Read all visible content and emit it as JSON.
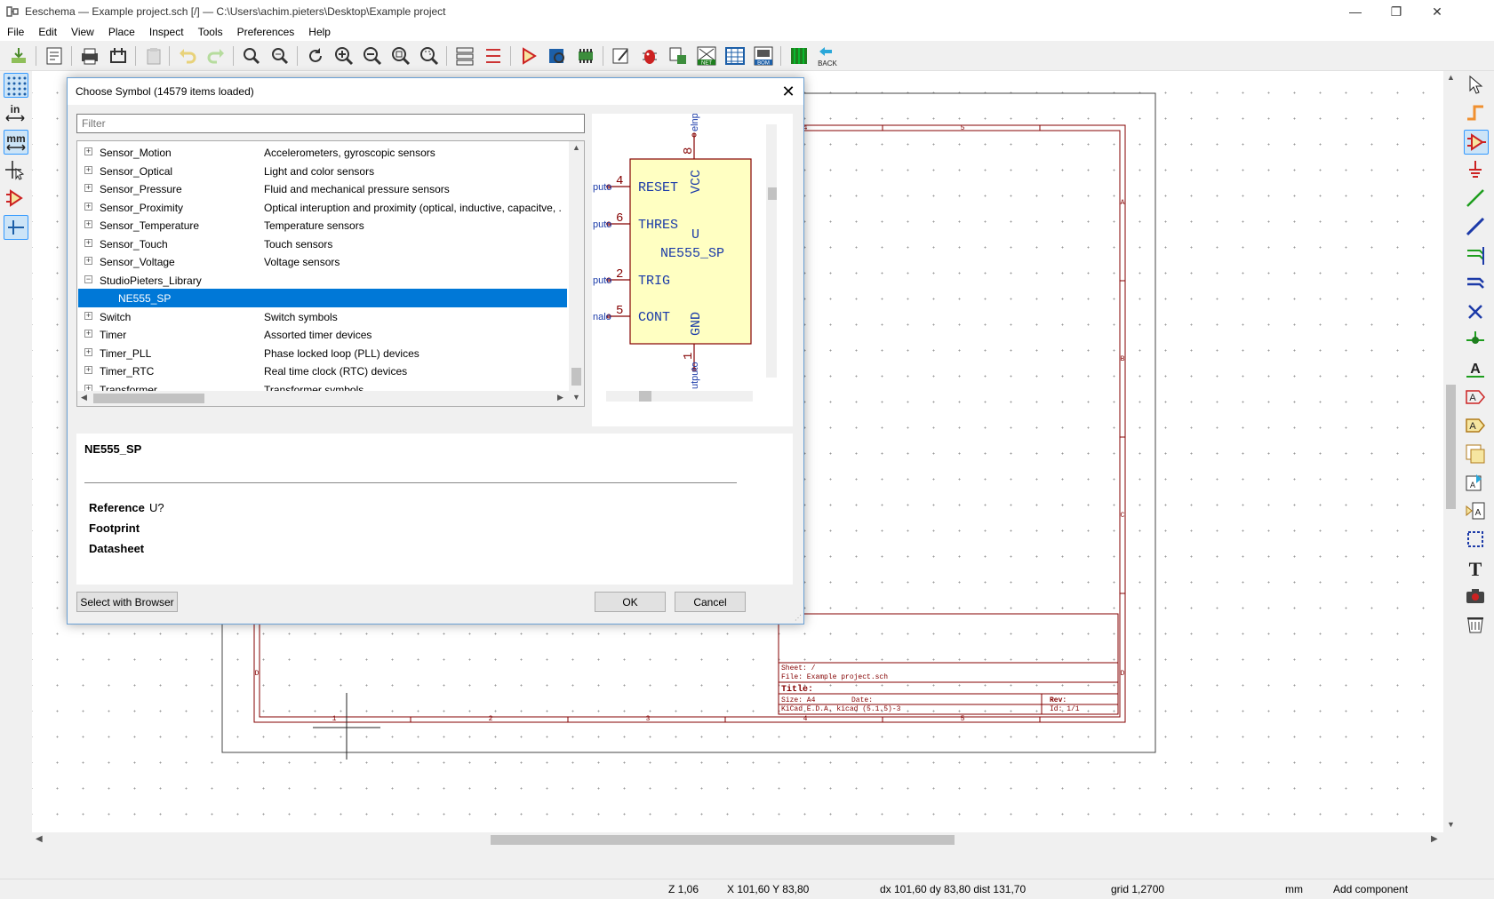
{
  "window": {
    "title": "Eeschema — Example project.sch [/] — C:\\Users\\achim.pieters\\Desktop\\Example project",
    "minimize_glyph": "—",
    "maximize_glyph": "❐",
    "close_glyph": "✕"
  },
  "menu": [
    "File",
    "Edit",
    "View",
    "Place",
    "Inspect",
    "Tools",
    "Preferences",
    "Help"
  ],
  "left_toolbar": {
    "units_in": "in",
    "units_mm": "mm"
  },
  "toolbar": {
    "back_label": "BACK",
    "net_label": "NET",
    "bom_label": "BOM"
  },
  "dialog": {
    "title": "Choose Symbol (14579 items loaded)",
    "close_glyph": "✕",
    "filter_placeholder": "Filter",
    "tree": [
      {
        "name": "Sensor_Motion",
        "desc": "Accelerometers, gyroscopic sensors",
        "exp": "+"
      },
      {
        "name": "Sensor_Optical",
        "desc": "Light and color sensors",
        "exp": "+"
      },
      {
        "name": "Sensor_Pressure",
        "desc": "Fluid and mechanical pressure sensors",
        "exp": "+"
      },
      {
        "name": "Sensor_Proximity",
        "desc": "Optical interuption and proximity (optical, inductive, capacitve, .",
        "exp": "+"
      },
      {
        "name": "Sensor_Temperature",
        "desc": "Temperature sensors",
        "exp": "+"
      },
      {
        "name": "Sensor_Touch",
        "desc": "Touch sensors",
        "exp": "+"
      },
      {
        "name": "Sensor_Voltage",
        "desc": "Voltage sensors",
        "exp": "+"
      },
      {
        "name": "StudioPieters_Library",
        "desc": "",
        "exp": "−"
      },
      {
        "name": "NE555_SP",
        "desc": "",
        "exp": ""
      },
      {
        "name": "Switch",
        "desc": "Switch symbols",
        "exp": "+"
      },
      {
        "name": "Timer",
        "desc": "Assorted timer devices",
        "exp": "+"
      },
      {
        "name": "Timer_PLL",
        "desc": "Phase locked loop (PLL) devices",
        "exp": "+"
      },
      {
        "name": "Timer_RTC",
        "desc": "Real time clock (RTC) devices",
        "exp": "+"
      },
      {
        "name": "Transformer",
        "desc": "Transformer symbols",
        "exp": "+"
      }
    ],
    "selected_index": 8,
    "preview": {
      "pins": [
        {
          "num": "4",
          "name": "RESET",
          "ext": "puto"
        },
        {
          "num": "6",
          "name": "THRES",
          "ext": "puto"
        },
        {
          "num": "2",
          "name": "TRIG",
          "ext": "puto"
        },
        {
          "num": "5",
          "name": "CONT",
          "ext": "nalo"
        }
      ],
      "top_pin_num": "8",
      "top_pin_name": "VCC",
      "top_ext": "elnput",
      "bottom_pin_num": "1",
      "bottom_pin_name": "GND",
      "bottom_ext": "utputo",
      "ref": "U",
      "value": "NE555_SP"
    },
    "info": {
      "symbol_name": "NE555_SP",
      "reference_label": "Reference",
      "reference_value": "U?",
      "footprint_label": "Footprint",
      "datasheet_label": "Datasheet"
    },
    "buttons": {
      "browser": "Select with Browser",
      "ok": "OK",
      "cancel": "Cancel"
    }
  },
  "title_block": {
    "sheet": "Sheet: /",
    "file": "File: Example project.sch",
    "title": "Title:",
    "size": "Size: A4",
    "date": "Date:",
    "rev": "Rev:",
    "kicad": "KiCad E.D.A.  kicad (5.1.5)-3",
    "id": "Id: 1/1"
  },
  "frame_labels": {
    "top": [
      "4",
      "5"
    ],
    "bottom": [
      "1",
      "2",
      "3",
      "4",
      "5"
    ],
    "right": [
      "A",
      "B",
      "C",
      "D"
    ],
    "left": [
      "D"
    ]
  },
  "status": {
    "zoom": "Z 1,06",
    "xy": "X 101,60  Y 83,80",
    "dxy": "dx 101,60  dy 83,80  dist 131,70",
    "grid": "grid 1,2700",
    "units": "mm",
    "mode": "Add component"
  },
  "colors": {
    "accent": "#0078d7",
    "sheet_frame": "#840000",
    "symbol_body": "#ffffc2",
    "symbol_pin": "#1a3aa8"
  }
}
